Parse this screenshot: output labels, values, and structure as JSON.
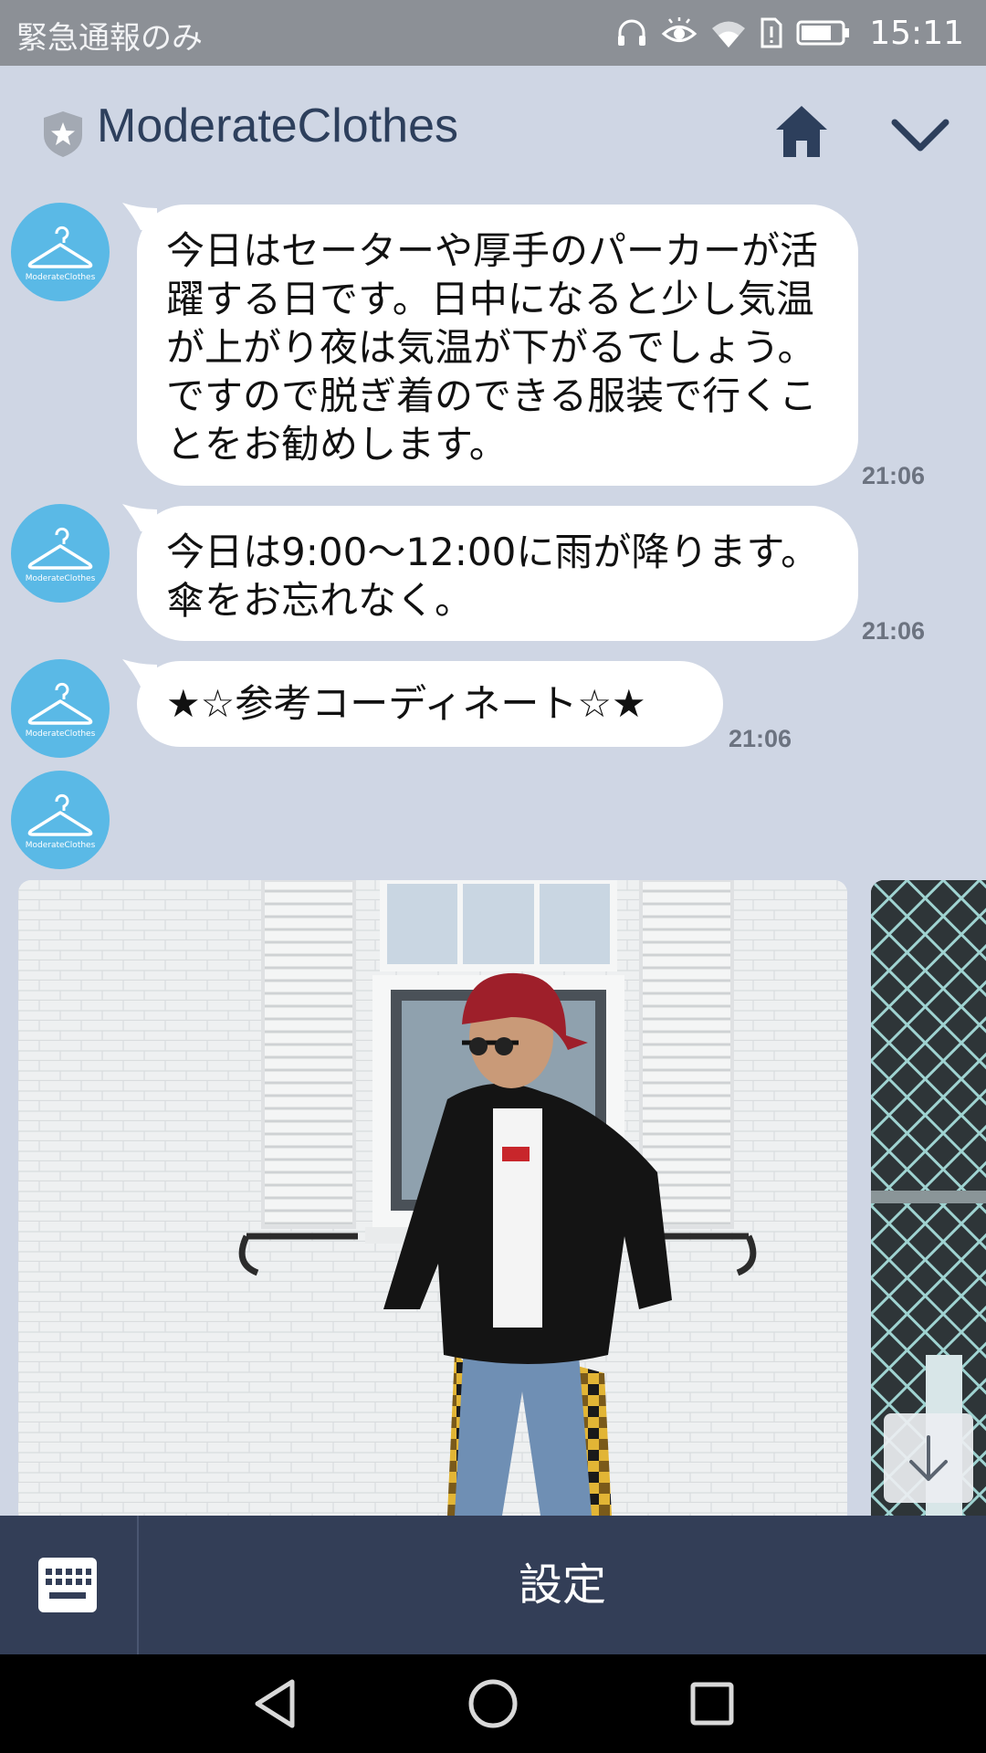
{
  "status_bar": {
    "left_text": "緊急通報のみ",
    "time": "15:11",
    "icons": [
      "headphones-icon",
      "eye-icon",
      "wifi-icon",
      "sim-alert-icon",
      "battery-icon"
    ]
  },
  "header": {
    "title": "ModerateClothes",
    "icons": [
      "shield-star-icon",
      "home-icon",
      "chevron-down-icon"
    ]
  },
  "messages": [
    {
      "text": "今日はセーターや厚手のパーカーが活躍する日です。日中になると少し気温が上がり夜は気温が下がるでしょう。ですので脱ぎ着のできる服装で行くことをお勧めします。",
      "time": "21:06"
    },
    {
      "text": "今日は9:00〜12:00に雨が降ります。傘をお忘れなく。",
      "time": "21:06"
    },
    {
      "text": "★☆参考コーディネート☆★",
      "time": "21:06"
    }
  ],
  "avatar": {
    "icon": "hanger-icon",
    "logo_text": "ModerateClothes",
    "color": "#5ab9e6"
  },
  "carousel": {
    "images": [
      "outfit-photo-1",
      "outfit-photo-2"
    ]
  },
  "bottom_menu": {
    "settings_label": "設定",
    "keyboard_icon": "keyboard-icon"
  },
  "nav_bar": {
    "icons": [
      "back-icon",
      "home-circle-icon",
      "recents-icon"
    ]
  },
  "colors": {
    "chat_background": "#cfd6e4",
    "header_text": "#2d3f5c",
    "bottom_bar": "#333e57",
    "status_bar": "#8c9096"
  }
}
